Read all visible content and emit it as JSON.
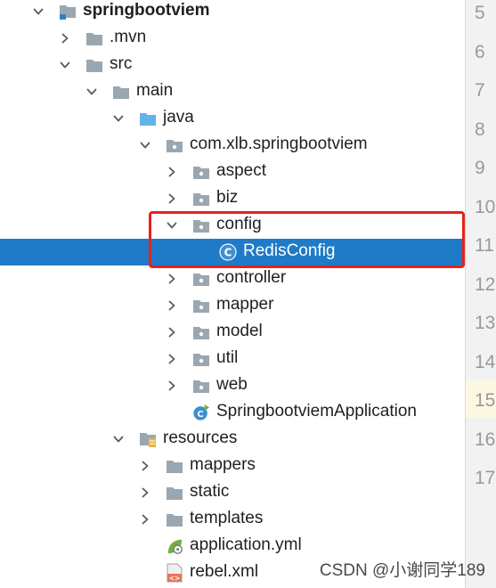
{
  "tree": {
    "items": [
      {
        "label": "springbootviem",
        "icon": "module-folder-icon",
        "arrow": "down"
      },
      {
        "label": ".mvn",
        "icon": "folder-icon",
        "arrow": "right"
      },
      {
        "label": "src",
        "icon": "folder-icon",
        "arrow": "down"
      },
      {
        "label": "main",
        "icon": "folder-icon",
        "arrow": "down"
      },
      {
        "label": "java",
        "icon": "source-folder-icon",
        "arrow": "down"
      },
      {
        "label": "com.xlb.springbootviem",
        "icon": "package-icon",
        "arrow": "down"
      },
      {
        "label": "aspect",
        "icon": "package-icon",
        "arrow": "right"
      },
      {
        "label": "biz",
        "icon": "package-icon",
        "arrow": "right"
      },
      {
        "label": "config",
        "icon": "package-icon",
        "arrow": "down"
      },
      {
        "label": "RedisConfig",
        "icon": "class-icon",
        "arrow": "none",
        "selected": true
      },
      {
        "label": "controller",
        "icon": "package-icon",
        "arrow": "right"
      },
      {
        "label": "mapper",
        "icon": "package-icon",
        "arrow": "right"
      },
      {
        "label": "model",
        "icon": "package-icon",
        "arrow": "right"
      },
      {
        "label": "util",
        "icon": "package-icon",
        "arrow": "right"
      },
      {
        "label": "web",
        "icon": "package-icon",
        "arrow": "right"
      },
      {
        "label": "SpringbootviemApplication",
        "icon": "spring-boot-class-icon",
        "arrow": "none"
      },
      {
        "label": "resources",
        "icon": "resources-folder-icon",
        "arrow": "down"
      },
      {
        "label": "mappers",
        "icon": "folder-icon",
        "arrow": "right"
      },
      {
        "label": "static",
        "icon": "folder-icon",
        "arrow": "right"
      },
      {
        "label": "templates",
        "icon": "folder-icon",
        "arrow": "right"
      },
      {
        "label": "application.yml",
        "icon": "yaml-config-icon",
        "arrow": "none"
      },
      {
        "label": "rebel.xml",
        "icon": "xml-file-icon",
        "arrow": "none"
      }
    ]
  },
  "gutter": {
    "line_numbers": [
      "5",
      "6",
      "7",
      "8",
      "9",
      "10",
      "11",
      "12",
      "13",
      "14",
      "15",
      "16",
      "17"
    ]
  },
  "watermark": "CSDN @小谢同学189",
  "colors": {
    "selection": "#1f7ac7",
    "highlight_box": "#e8201b",
    "folder": "#9aa7b0",
    "source_folder": "#62b3e8",
    "class_icon": "#3f8fd2"
  }
}
